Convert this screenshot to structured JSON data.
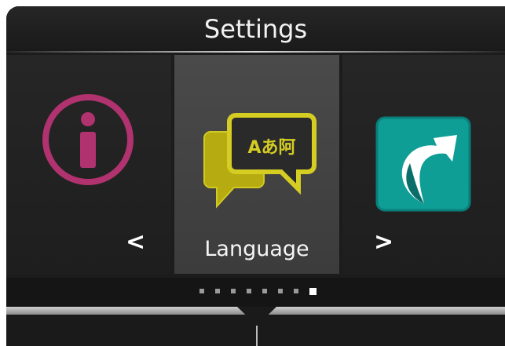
{
  "header": {
    "title": "Settings"
  },
  "carousel": {
    "items": [
      {
        "icon": "info-icon",
        "color": "#b0326e"
      },
      {
        "icon": "language-icon",
        "label": "Language",
        "color": "#c9c21a",
        "glyphs": "Aあ阿"
      },
      {
        "icon": "shortcut-icon",
        "color": "#0f9e96"
      }
    ],
    "prev_arrow": "<",
    "next_arrow": ">"
  },
  "pagination": {
    "total": 8,
    "active_index": 7
  }
}
